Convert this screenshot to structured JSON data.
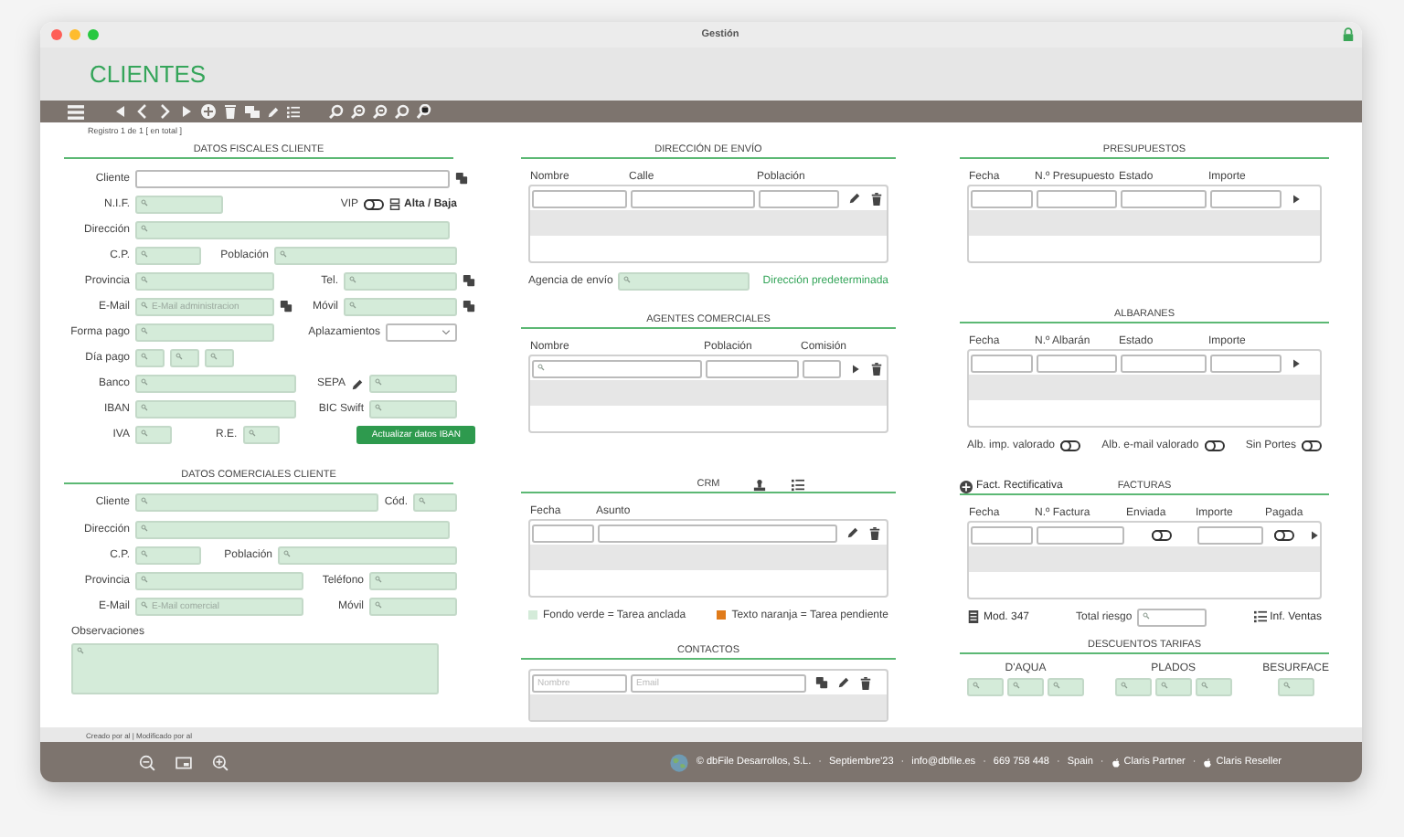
{
  "window": {
    "title": "Gestión"
  },
  "header": {
    "title": "CLIENTES"
  },
  "record_info": "Registro 1 de 1 [  en total ]",
  "columns": [
    {
      "sections": [
        {
          "kind": "form",
          "title": "DATOS FISCALES CLIENTE",
          "rows": [
            [
              {
                "kind": "label",
                "text": "Cliente"
              },
              {
                "kind": "entry"
              },
              {
                "kind": "copy"
              }
            ],
            [
              {
                "kind": "label",
                "text": "N.I.F."
              },
              {
                "kind": "field"
              },
              {
                "kind": "label",
                "text": "VIP"
              },
              {
                "kind": "toggle",
                "on": false
              },
              {
                "kind": "action",
                "text": "Alta / Baja"
              }
            ],
            [
              {
                "kind": "label",
                "text": "Dirección"
              },
              {
                "kind": "field"
              }
            ],
            [
              {
                "kind": "label",
                "text": "C.P."
              },
              {
                "kind": "field"
              },
              {
                "kind": "label",
                "text": "Población"
              },
              {
                "kind": "field"
              }
            ],
            [
              {
                "kind": "label",
                "text": "Provincia"
              },
              {
                "kind": "field"
              },
              {
                "kind": "label",
                "text": "Tel."
              },
              {
                "kind": "field"
              },
              {
                "kind": "copy"
              }
            ],
            [
              {
                "kind": "label",
                "text": "E-Mail"
              },
              {
                "kind": "field",
                "placeholder": "E-Mail administracion"
              },
              {
                "kind": "copy"
              },
              {
                "kind": "label",
                "text": "Móvil"
              },
              {
                "kind": "field"
              },
              {
                "kind": "copy"
              }
            ],
            [
              {
                "kind": "label",
                "text": "Forma pago"
              },
              {
                "kind": "field"
              },
              {
                "kind": "label",
                "text": "Aplazamientos"
              },
              {
                "kind": "select"
              }
            ],
            [
              {
                "kind": "label",
                "text": "Día pago"
              },
              {
                "kind": "field"
              },
              {
                "kind": "field"
              },
              {
                "kind": "field"
              }
            ],
            [
              {
                "kind": "label",
                "text": "Banco"
              },
              {
                "kind": "field"
              },
              {
                "kind": "label",
                "text": "SEPA"
              },
              {
                "kind": "pen"
              },
              {
                "kind": "field"
              }
            ],
            [
              {
                "kind": "label",
                "text": "IBAN"
              },
              {
                "kind": "field"
              },
              {
                "kind": "label",
                "text": "BIC Swift"
              },
              {
                "kind": "field"
              }
            ],
            [
              {
                "kind": "label",
                "text": "IVA"
              },
              {
                "kind": "field"
              },
              {
                "kind": "label",
                "text": "R.E."
              },
              {
                "kind": "field"
              },
              {
                "kind": "button",
                "text": "Actualizar datos IBAN"
              }
            ]
          ]
        },
        {
          "kind": "form",
          "title": "DATOS COMERCIALES CLIENTE",
          "notes_label": "Observaciones",
          "rows": [
            [
              {
                "kind": "label",
                "text": "Cliente"
              },
              {
                "kind": "field"
              },
              {
                "kind": "label",
                "text": "Cód."
              },
              {
                "kind": "field"
              }
            ],
            [
              {
                "kind": "label",
                "text": "Dirección"
              },
              {
                "kind": "field"
              }
            ],
            [
              {
                "kind": "label",
                "text": "C.P."
              },
              {
                "kind": "field"
              },
              {
                "kind": "label",
                "text": "Población"
              },
              {
                "kind": "field"
              }
            ],
            [
              {
                "kind": "label",
                "text": "Provincia"
              },
              {
                "kind": "field"
              },
              {
                "kind": "label",
                "text": "Teléfono"
              },
              {
                "kind": "field"
              }
            ],
            [
              {
                "kind": "label",
                "text": "E-Mail"
              },
              {
                "kind": "field",
                "placeholder": "E-Mail comercial"
              },
              {
                "kind": "label",
                "text": "Móvil"
              },
              {
                "kind": "field"
              }
            ]
          ]
        }
      ]
    },
    {
      "sections": [
        {
          "kind": "table",
          "title": "DIRECCIÓN DE ENVÍO",
          "columns": [
            {
              "label": "Nombre",
              "kind": "entry"
            },
            {
              "label": "Calle",
              "kind": "entry"
            },
            {
              "label": "Población",
              "kind": "entry"
            }
          ],
          "actions": [
            {
              "kind": "edit"
            },
            {
              "kind": "delete"
            }
          ],
          "footer": [
            [
              {
                "kind": "label",
                "text": "Agencia de envío"
              },
              {
                "kind": "field"
              }
            ],
            [
              {
                "kind": "link",
                "text": "Dirección predeterminada"
              }
            ]
          ]
        },
        {
          "kind": "table",
          "title": "AGENTES COMERCIALES",
          "columns": [
            {
              "label": "Nombre",
              "kind": "lookup"
            },
            {
              "label": "Población",
              "kind": "entry"
            },
            {
              "label": "Comisión",
              "kind": "entry"
            }
          ],
          "actions": [
            {
              "kind": "play"
            },
            {
              "kind": "delete"
            }
          ]
        },
        {
          "kind": "table",
          "title": "CRM",
          "title_actions": [
            {
              "kind": "stamp"
            },
            {
              "kind": "list"
            }
          ],
          "columns": [
            {
              "label": "Fecha",
              "kind": "entry"
            },
            {
              "label": "Asunto",
              "kind": "entry"
            }
          ],
          "actions": [
            {
              "kind": "edit"
            },
            {
              "kind": "delete"
            }
          ],
          "footer": [
            [
              {
                "kind": "legend",
                "color": "#d4ebd9",
                "text": "Fondo verde = Tarea anclada"
              }
            ],
            [
              {
                "kind": "legend",
                "color": "#e07b1a",
                "text": "Texto naranja = Tarea pendiente"
              }
            ]
          ]
        },
        {
          "kind": "table",
          "title": "CONTACTOS",
          "columns": [
            {
              "placeholder": "Nombre",
              "kind": "entry"
            },
            {
              "placeholder": "Email",
              "kind": "entry"
            }
          ],
          "actions": [
            {
              "kind": "copy"
            },
            {
              "kind": "edit"
            },
            {
              "kind": "delete"
            }
          ]
        }
      ]
    },
    {
      "sections": [
        {
          "kind": "table",
          "title": "PRESUPUESTOS",
          "columns": [
            {
              "label": "Fecha",
              "kind": "entry"
            },
            {
              "label": "N.º Presupuesto",
              "kind": "entry"
            },
            {
              "label": "Estado",
              "kind": "entry"
            },
            {
              "label": "Importe",
              "kind": "entry"
            }
          ],
          "actions": [
            {
              "kind": "play"
            }
          ]
        },
        {
          "kind": "table",
          "title": "ALBARANES",
          "columns": [
            {
              "label": "Fecha",
              "kind": "entry"
            },
            {
              "label": "N.º Albarán",
              "kind": "entry"
            },
            {
              "label": "Estado",
              "kind": "entry"
            },
            {
              "label": "Importe",
              "kind": "entry"
            }
          ],
          "actions": [
            {
              "kind": "play"
            }
          ],
          "footer": [
            [
              {
                "kind": "label",
                "text": "Alb. imp. valorado"
              },
              {
                "kind": "toggle",
                "on": false
              }
            ],
            [
              {
                "kind": "label",
                "text": "Alb. e-mail valorado"
              },
              {
                "kind": "toggle",
                "on": false
              }
            ],
            [
              {
                "kind": "label",
                "text": "Sin Portes"
              },
              {
                "kind": "toggle",
                "on": false
              }
            ]
          ]
        },
        {
          "kind": "table",
          "title": "FACTURAS",
          "title_lead": {
            "kind": "add",
            "text": "Fact. Rectificativa"
          },
          "columns": [
            {
              "label": "Fecha",
              "kind": "entry"
            },
            {
              "label": "N.º Factura",
              "kind": "entry"
            },
            {
              "label": "Enviada",
              "kind": "toggle",
              "on": false
            },
            {
              "label": "Importe",
              "kind": "entry"
            },
            {
              "label": "Pagada",
              "kind": "toggle",
              "on": false
            }
          ],
          "actions": [
            {
              "kind": "play"
            }
          ],
          "footer": [
            [
              {
                "kind": "report",
                "text": "Mod. 347"
              }
            ],
            [
              {
                "kind": "label",
                "text": "Total riesgo"
              },
              {
                "kind": "lookup"
              }
            ],
            [
              {
                "kind": "listing",
                "text": "Inf. Ventas"
              }
            ]
          ]
        },
        {
          "kind": "discounts",
          "title": "DESCUENTOS TARIFAS",
          "groups": [
            {
              "label": "D'AQUA",
              "fields": [
                {
                  "kind": "field"
                },
                {
                  "kind": "field"
                },
                {
                  "kind": "field"
                }
              ]
            },
            {
              "label": "PLADOS",
              "fields": [
                {
                  "kind": "field"
                },
                {
                  "kind": "field"
                },
                {
                  "kind": "field"
                }
              ]
            },
            {
              "label": "BESURFACE",
              "fields": [
                {
                  "kind": "field"
                }
              ]
            }
          ]
        }
      ]
    }
  ],
  "audit": "Creado por  al  |  Modificado por  al",
  "footer": [
    {
      "kind": "text",
      "text": "© dbFile Desarrollos, S.L."
    },
    {
      "kind": "sep",
      "text": "·"
    },
    {
      "kind": "text",
      "text": "Septiembre'23"
    },
    {
      "kind": "sep",
      "text": "·"
    },
    {
      "kind": "text",
      "text": "info@dbfile.es"
    },
    {
      "kind": "sep",
      "text": "·"
    },
    {
      "kind": "text",
      "text": "669 758 448"
    },
    {
      "kind": "sep",
      "text": "·"
    },
    {
      "kind": "text",
      "text": "Spain"
    },
    {
      "kind": "sep",
      "text": "·"
    },
    {
      "kind": "partner",
      "text": "Claris Partner"
    },
    {
      "kind": "sep",
      "text": "·"
    },
    {
      "kind": "partner",
      "text": "Claris Reseller"
    }
  ]
}
